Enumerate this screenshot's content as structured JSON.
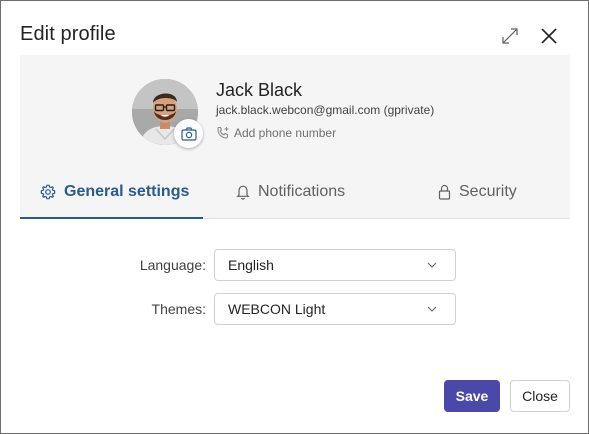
{
  "dialog": {
    "title": "Edit profile",
    "expand_icon": "expand-icon",
    "close_icon": "close-icon"
  },
  "profile": {
    "name": "Jack Black",
    "email": "jack.black.webcon@gmail.com (gprivate)",
    "add_phone_label": "Add phone number",
    "phone_icon": "phone-add-icon",
    "camera_icon": "camera-icon"
  },
  "tabs": [
    {
      "label": "General settings",
      "icon": "gear-icon",
      "active": true
    },
    {
      "label": "Notifications",
      "icon": "bell-icon",
      "active": false
    },
    {
      "label": "Security",
      "icon": "lock-icon",
      "active": false
    }
  ],
  "form": {
    "language": {
      "label": "Language:",
      "value": "English"
    },
    "themes": {
      "label": "Themes:",
      "value": "WEBCON Light"
    }
  },
  "footer": {
    "save_label": "Save",
    "close_label": "Close"
  },
  "colors": {
    "accent": "#2c5a8c",
    "primary_button": "#4a48a8",
    "panel_bg": "#f5f5f5"
  }
}
